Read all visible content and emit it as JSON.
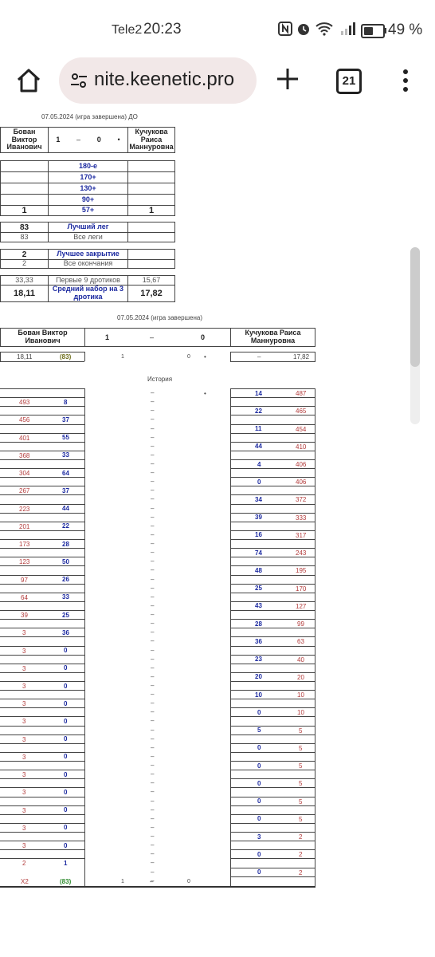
{
  "status_bar": {
    "carrier": "Tele2",
    "time": "20:23",
    "battery": "49 %",
    "battery_level": 0.49
  },
  "browser": {
    "url": "nite.keenetic.pro",
    "tab_count": "21"
  },
  "summary": {
    "date_line": "07.05.2024 (игра завершена) ДО",
    "player1": "Бован Виктор Иванович",
    "player2": "Кучукова Раиса Маннуровна",
    "score1": "1",
    "score_sep": "–",
    "score2": "0",
    "turn_dot": "•",
    "stats": [
      {
        "label": "180-е",
        "p1": "",
        "p2": ""
      },
      {
        "label": "170+",
        "p1": "",
        "p2": ""
      },
      {
        "label": "130+",
        "p1": "",
        "p2": ""
      },
      {
        "label": "90+",
        "p1": "",
        "p2": ""
      },
      {
        "label": "57+",
        "p1": "1",
        "p2": "1"
      }
    ],
    "best_leg": {
      "label": "Лучший лег",
      "p1": "83",
      "p2": ""
    },
    "all_legs": {
      "label": "Все леги",
      "p1": "83",
      "p2": ""
    },
    "best_finish": {
      "label": "Лучшее закрытие",
      "p1": "2",
      "p2": ""
    },
    "all_finishes": {
      "label": "Все окончания",
      "p1": "2",
      "p2": ""
    },
    "first9": {
      "label": "Первые 9 дротиков",
      "p1": "33,33",
      "p2": "15,67"
    },
    "avg3": {
      "label": "Средний набор на 3 дротика",
      "p1": "18,11",
      "p2": "17,82"
    }
  },
  "leg": {
    "date_line": "07.05.2024 (игра завершена)",
    "player1": "Бован Виктор Иванович",
    "player2": "Кучукова Раиса Маннуровна",
    "legs1": "1",
    "dash": "–",
    "legs2": "0",
    "avg1": "18,11",
    "best1": "(83)",
    "sets1": "1",
    "sets2": "0",
    "dot": "•",
    "avg2_dash": "–",
    "avg2": "17,82",
    "history_label": "История",
    "p1_rows": [
      {
        "rem": "493",
        "score": "8"
      },
      {
        "rem": "456",
        "score": "37"
      },
      {
        "rem": "401",
        "score": "55"
      },
      {
        "rem": "368",
        "score": "33"
      },
      {
        "rem": "304",
        "score": "64"
      },
      {
        "rem": "267",
        "score": "37"
      },
      {
        "rem": "223",
        "score": "44"
      },
      {
        "rem": "201",
        "score": "22"
      },
      {
        "rem": "173",
        "score": "28"
      },
      {
        "rem": "123",
        "score": "50"
      },
      {
        "rem": "97",
        "score": "26"
      },
      {
        "rem": "64",
        "score": "33"
      },
      {
        "rem": "39",
        "score": "25"
      },
      {
        "rem": "3",
        "score": "36"
      },
      {
        "rem": "3",
        "score": "0"
      },
      {
        "rem": "3",
        "score": "0"
      },
      {
        "rem": "3",
        "score": "0"
      },
      {
        "rem": "3",
        "score": "0"
      },
      {
        "rem": "3",
        "score": "0"
      },
      {
        "rem": "3",
        "score": "0"
      },
      {
        "rem": "3",
        "score": "0"
      },
      {
        "rem": "3",
        "score": "0"
      },
      {
        "rem": "3",
        "score": "0"
      },
      {
        "rem": "3",
        "score": "0"
      },
      {
        "rem": "3",
        "score": "0"
      },
      {
        "rem": "3",
        "score": "0"
      },
      {
        "rem": "2",
        "score": "1"
      }
    ],
    "p2_rows": [
      {
        "score": "14",
        "rem": "487"
      },
      {
        "score": "22",
        "rem": "465"
      },
      {
        "score": "11",
        "rem": "454"
      },
      {
        "score": "44",
        "rem": "410"
      },
      {
        "score": "4",
        "rem": "406"
      },
      {
        "score": "0",
        "rem": "406"
      },
      {
        "score": "34",
        "rem": "372"
      },
      {
        "score": "39",
        "rem": "333"
      },
      {
        "score": "16",
        "rem": "317"
      },
      {
        "score": "74",
        "rem": "243"
      },
      {
        "score": "48",
        "rem": "195"
      },
      {
        "score": "25",
        "rem": "170"
      },
      {
        "score": "43",
        "rem": "127"
      },
      {
        "score": "28",
        "rem": "99"
      },
      {
        "score": "36",
        "rem": "63"
      },
      {
        "score": "23",
        "rem": "40"
      },
      {
        "score": "20",
        "rem": "20"
      },
      {
        "score": "10",
        "rem": "10"
      },
      {
        "score": "0",
        "rem": "10"
      },
      {
        "score": "5",
        "rem": "5"
      },
      {
        "score": "0",
        "rem": "5"
      },
      {
        "score": "0",
        "rem": "5"
      },
      {
        "score": "0",
        "rem": "5"
      },
      {
        "score": "0",
        "rem": "5"
      },
      {
        "score": "0",
        "rem": "5"
      },
      {
        "score": "3",
        "rem": "2"
      },
      {
        "score": "0",
        "rem": "2"
      },
      {
        "score": "0",
        "rem": "2"
      }
    ],
    "final": {
      "p1_tag": "X2",
      "p1_best": "(83)",
      "sets1": "1",
      "dash": "–",
      "sets2": "0"
    }
  }
}
